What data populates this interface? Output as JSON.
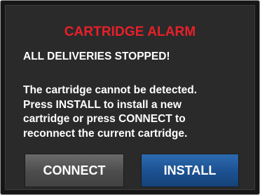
{
  "alarm": {
    "title": "CARTRIDGE ALARM",
    "title_color": "#e8202a",
    "subtitle": "ALL DELIVERIES STOPPED!",
    "message_lines": [
      "The cartridge cannot be detected.",
      "Press INSTALL to install a new",
      "cartridge or press CONNECT to",
      "reconnect the current cartridge."
    ]
  },
  "buttons": {
    "connect_label": "CONNECT",
    "install_label": "INSTALL"
  },
  "colors": {
    "screen_background": "#2a2a2a",
    "connect_button": "#4c4c4c",
    "install_button": "#1c5090",
    "text": "#ffffff"
  }
}
